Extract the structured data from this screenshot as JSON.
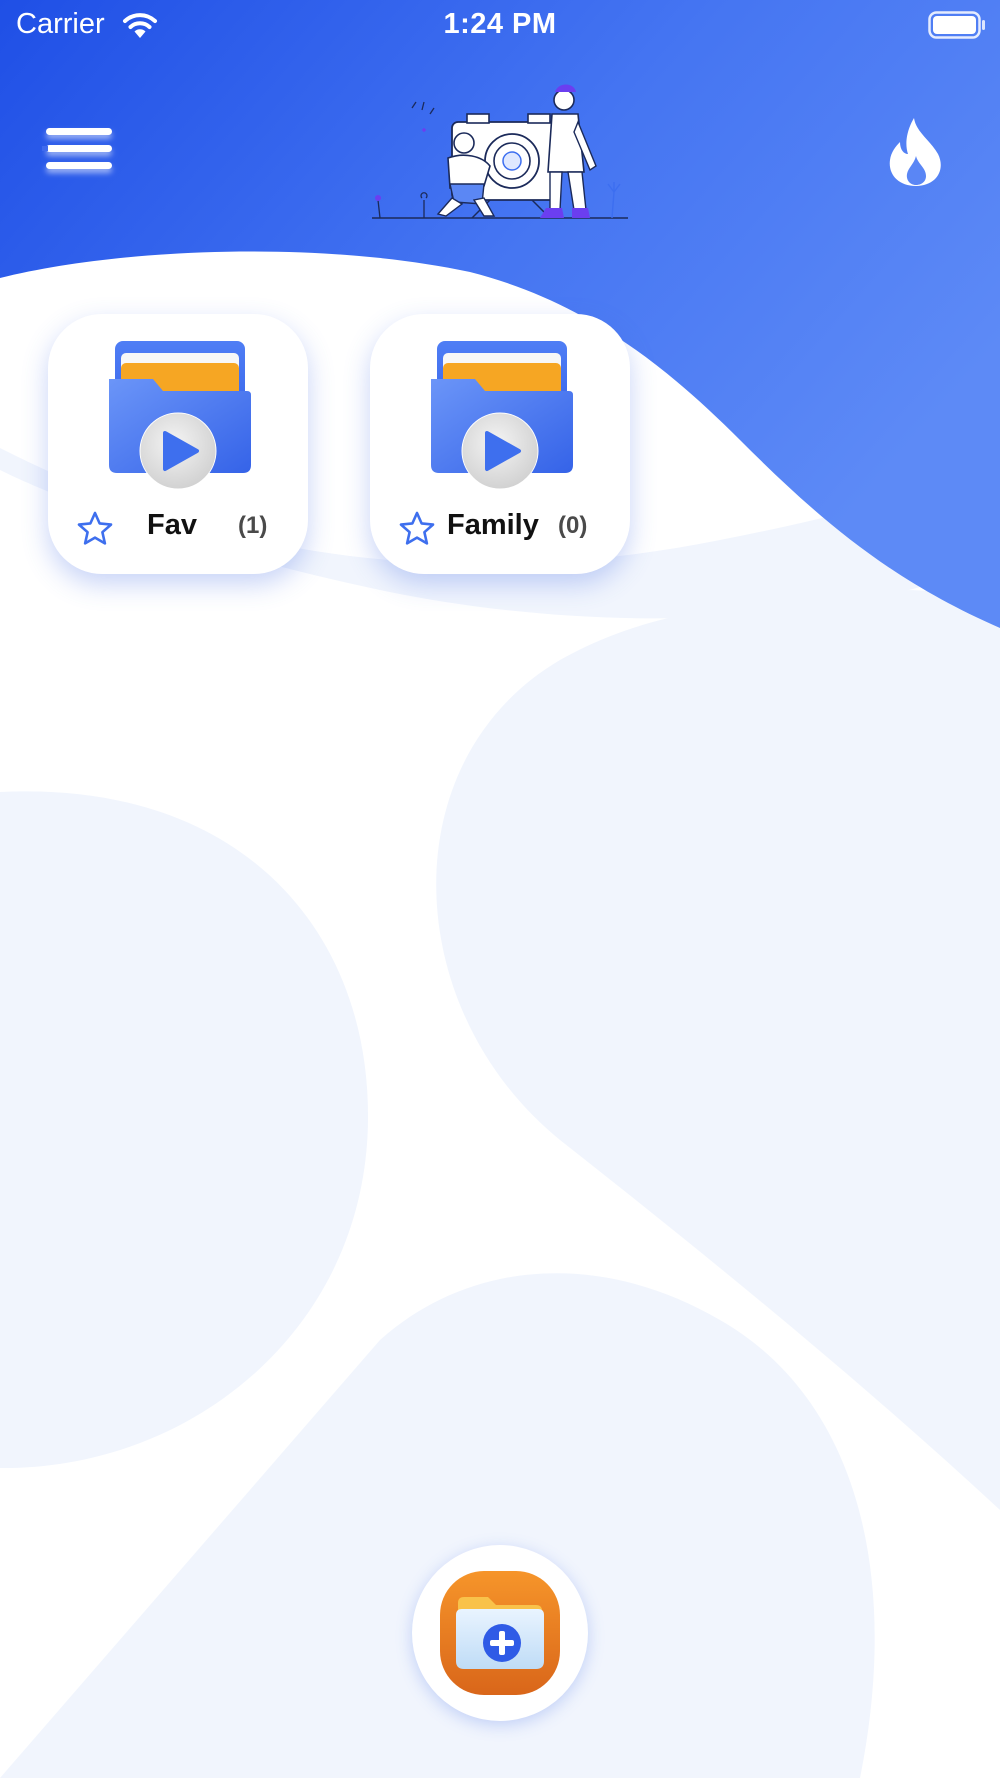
{
  "status_bar": {
    "carrier": "Carrier",
    "time": "1:24 PM"
  },
  "header": {
    "menu_icon": "hamburger-menu-icon",
    "illustration": "people-with-camera-illustration",
    "action_icon": "fire-icon"
  },
  "folders": [
    {
      "name": "Fav",
      "count": "(1)",
      "icon": "video-folder-icon",
      "favorite_icon": "star-outline-icon"
    },
    {
      "name": "Family",
      "count": "(0)",
      "icon": "video-folder-icon",
      "favorite_icon": "star-outline-icon"
    }
  ],
  "add_folder": {
    "icon": "add-folder-icon"
  },
  "colors": {
    "primary_blue": "#2f5cf0",
    "primary_blue_light": "#5a86f5",
    "background_blob": "#f1f5fd",
    "folder_accent": "#f6a623",
    "add_button_orange": "#e07a1c"
  }
}
